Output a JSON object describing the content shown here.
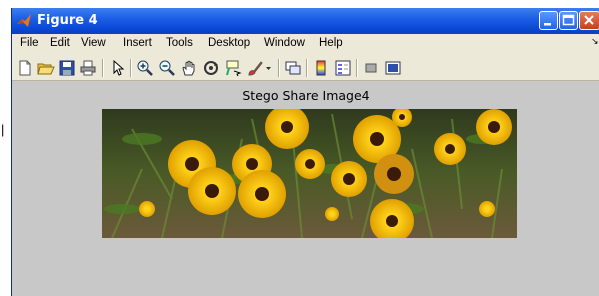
{
  "window": {
    "title": "Figure 4"
  },
  "menu": [
    "File",
    "Edit",
    "View",
    "Insert",
    "Tools",
    "Desktop",
    "Window",
    "Help"
  ],
  "toolbar": {
    "icons": [
      "new-figure-icon",
      "open-file-icon",
      "save-icon",
      "print-icon",
      "select-arrow-icon",
      "zoom-in-icon",
      "zoom-out-icon",
      "pan-hand-icon",
      "rotate-3d-icon",
      "data-cursor-icon",
      "brush-icon",
      "brush-dropdown-icon",
      "link-plot-icon",
      "colorbar-icon",
      "legend-icon",
      "hide-plot-tools-icon",
      "show-plot-tools-icon"
    ]
  },
  "figure": {
    "axes_title": "Stego Share Image4"
  },
  "colors": {
    "title_bar": "#0a48d6",
    "figure_bg": "#c8c8c8",
    "menu_bg": "#ece9d8"
  }
}
